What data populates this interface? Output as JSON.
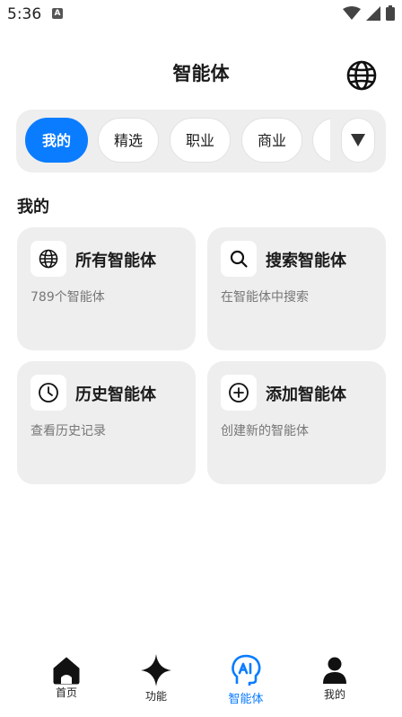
{
  "status": {
    "time": "5:36",
    "notif_letter": "A"
  },
  "header": {
    "title": "智能体",
    "language_icon": "globe-icon"
  },
  "categories": {
    "items": [
      {
        "label": "我的",
        "active": true
      },
      {
        "label": "精选",
        "active": false
      },
      {
        "label": "职业",
        "active": false
      },
      {
        "label": "商业",
        "active": false
      },
      {
        "label": "工",
        "active": false
      }
    ],
    "dropdown_icon": "triangle-down-icon"
  },
  "section": {
    "title": "我的"
  },
  "cards": [
    {
      "icon": "globe-icon",
      "title": "所有智能体",
      "subtitle": "789个智能体"
    },
    {
      "icon": "search-icon",
      "title": "搜索智能体",
      "subtitle": "在智能体中搜索"
    },
    {
      "icon": "clock-icon",
      "title": "历史智能体",
      "subtitle": "查看历史记录"
    },
    {
      "icon": "plus-circle-icon",
      "title": "添加智能体",
      "subtitle": "创建新的智能体"
    }
  ],
  "nav": [
    {
      "label": "首页",
      "icon": "home-icon",
      "active": false
    },
    {
      "label": "功能",
      "icon": "sparkle-icon",
      "active": false
    },
    {
      "label": "智能体",
      "icon": "ai-head-icon",
      "active": true
    },
    {
      "label": "我的",
      "icon": "person-icon",
      "active": false
    }
  ],
  "colors": {
    "accent": "#0a7cff",
    "card_bg": "#eeeeee",
    "text": "#1a1a1a",
    "muted": "#777777"
  }
}
